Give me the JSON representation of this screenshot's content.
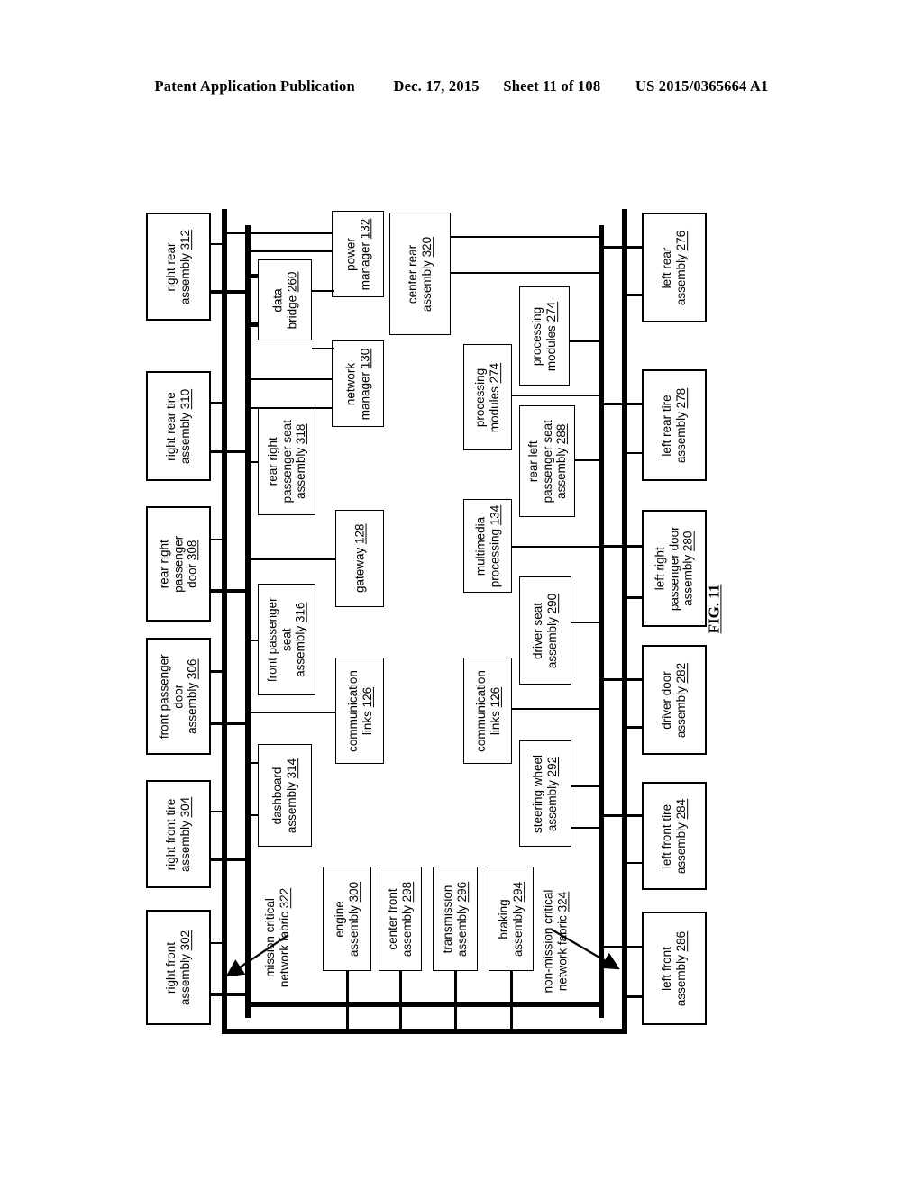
{
  "header": {
    "publication": "Patent Application Publication",
    "date": "Dec. 17, 2015",
    "sheet": "Sheet 11 of 108",
    "number": "US 2015/0365664 A1"
  },
  "figure": {
    "caption": "FIG. 11",
    "fabric_labels": [
      {
        "id": "mission-critical-network-fabric",
        "line1": "mission critical",
        "line2": "network fabric",
        "ref": "322"
      },
      {
        "id": "non-mission-critical-network-fabric",
        "line1": "non-mission critical",
        "line2": "network fabric",
        "ref": "324"
      }
    ],
    "right_side_assemblies": [
      {
        "id": "right-rear-assembly",
        "line1": "right rear",
        "line2": "assembly",
        "ref": "312"
      },
      {
        "id": "right-rear-tire-assembly",
        "line1": "right rear tire",
        "line2": "assembly",
        "ref": "310"
      },
      {
        "id": "rear-right-passenger-door",
        "line1": "rear right",
        "line2": "passenger",
        "line3": "door",
        "ref": "308"
      },
      {
        "id": "front-passenger-door-assembly",
        "line1": "front passenger",
        "line2": "door",
        "line3": "assembly",
        "ref": "306"
      },
      {
        "id": "right-front-tire-assembly",
        "line1": "right front tire",
        "line2": "assembly",
        "ref": "304"
      },
      {
        "id": "right-front-assembly",
        "line1": "right front",
        "line2": "assembly",
        "ref": "302"
      }
    ],
    "left_side_assemblies": [
      {
        "id": "left-rear-assembly",
        "line1": "left rear",
        "line2": "assembly",
        "ref": "276"
      },
      {
        "id": "left-rear-tire-assembly",
        "line1": "left rear tire",
        "line2": "assembly",
        "ref": "278"
      },
      {
        "id": "left-right-passenger-door-assembly",
        "line1": "left right",
        "line2": "passenger door",
        "line3": "assembly",
        "ref": "280"
      },
      {
        "id": "driver-door-assembly",
        "line1": "driver door",
        "line2": "assembly",
        "ref": "282"
      },
      {
        "id": "left-front-tire-assembly",
        "line1": "left front tire",
        "line2": "assembly",
        "ref": "284"
      },
      {
        "id": "left-front-assembly",
        "line1": "left front",
        "line2": "assembly",
        "ref": "286"
      }
    ],
    "inner_nodes": [
      {
        "id": "power-manager",
        "line1": "power",
        "line2": "manager",
        "ref": "132"
      },
      {
        "id": "data-bridge",
        "line1": "data",
        "line2": "bridge",
        "ref": "260"
      },
      {
        "id": "network-manager",
        "line1": "network",
        "line2": "manager",
        "ref": "130"
      },
      {
        "id": "center-rear-assembly",
        "line1": "center rear",
        "line2": "assembly",
        "ref": "320"
      },
      {
        "id": "processing-modules-upper",
        "line1": "processing",
        "line2": "modules",
        "ref": "274"
      },
      {
        "id": "processing-modules-lower",
        "line1": "processing",
        "line2": "modules",
        "ref": "274"
      },
      {
        "id": "rear-right-passenger-seat-assembly",
        "line1": "rear right",
        "line2": "passenger seat",
        "line3": "assembly",
        "ref": "318"
      },
      {
        "id": "rear-left-passenger-seat-assembly",
        "line1": "rear left",
        "line2": "passenger seat",
        "line3": "assembly",
        "ref": "288"
      },
      {
        "id": "gateway",
        "line1": "gateway",
        "ref": "128"
      },
      {
        "id": "multimedia-processing",
        "line1": "multimedia",
        "line2": "processing",
        "ref": "134"
      },
      {
        "id": "front-passenger-seat-assembly",
        "line1": "front passenger",
        "line2": "seat",
        "line3": "assembly",
        "ref": "316"
      },
      {
        "id": "driver-seat-assembly",
        "line1": "driver seat",
        "line2": "assembly",
        "ref": "290"
      },
      {
        "id": "communication-links-left",
        "line1": "communication",
        "line2": "links",
        "ref": "126"
      },
      {
        "id": "communication-links-right",
        "line1": "communication",
        "line2": "links",
        "ref": "126"
      },
      {
        "id": "dashboard-assembly",
        "line1": "dashboard",
        "line2": "assembly",
        "ref": "314"
      },
      {
        "id": "steering-wheel-assembly",
        "line1": "steering wheel",
        "line2": "assembly",
        "ref": "292"
      },
      {
        "id": "engine-assembly",
        "line1": "engine",
        "line2": "assembly",
        "ref": "300"
      },
      {
        "id": "center-front-assembly",
        "line1": "center front",
        "line2": "assembly",
        "ref": "298"
      },
      {
        "id": "transmission-assembly",
        "line1": "transmission",
        "line2": "assembly",
        "ref": "296"
      },
      {
        "id": "braking-assembly",
        "line1": "braking",
        "line2": "assembly",
        "ref": "294"
      }
    ]
  }
}
